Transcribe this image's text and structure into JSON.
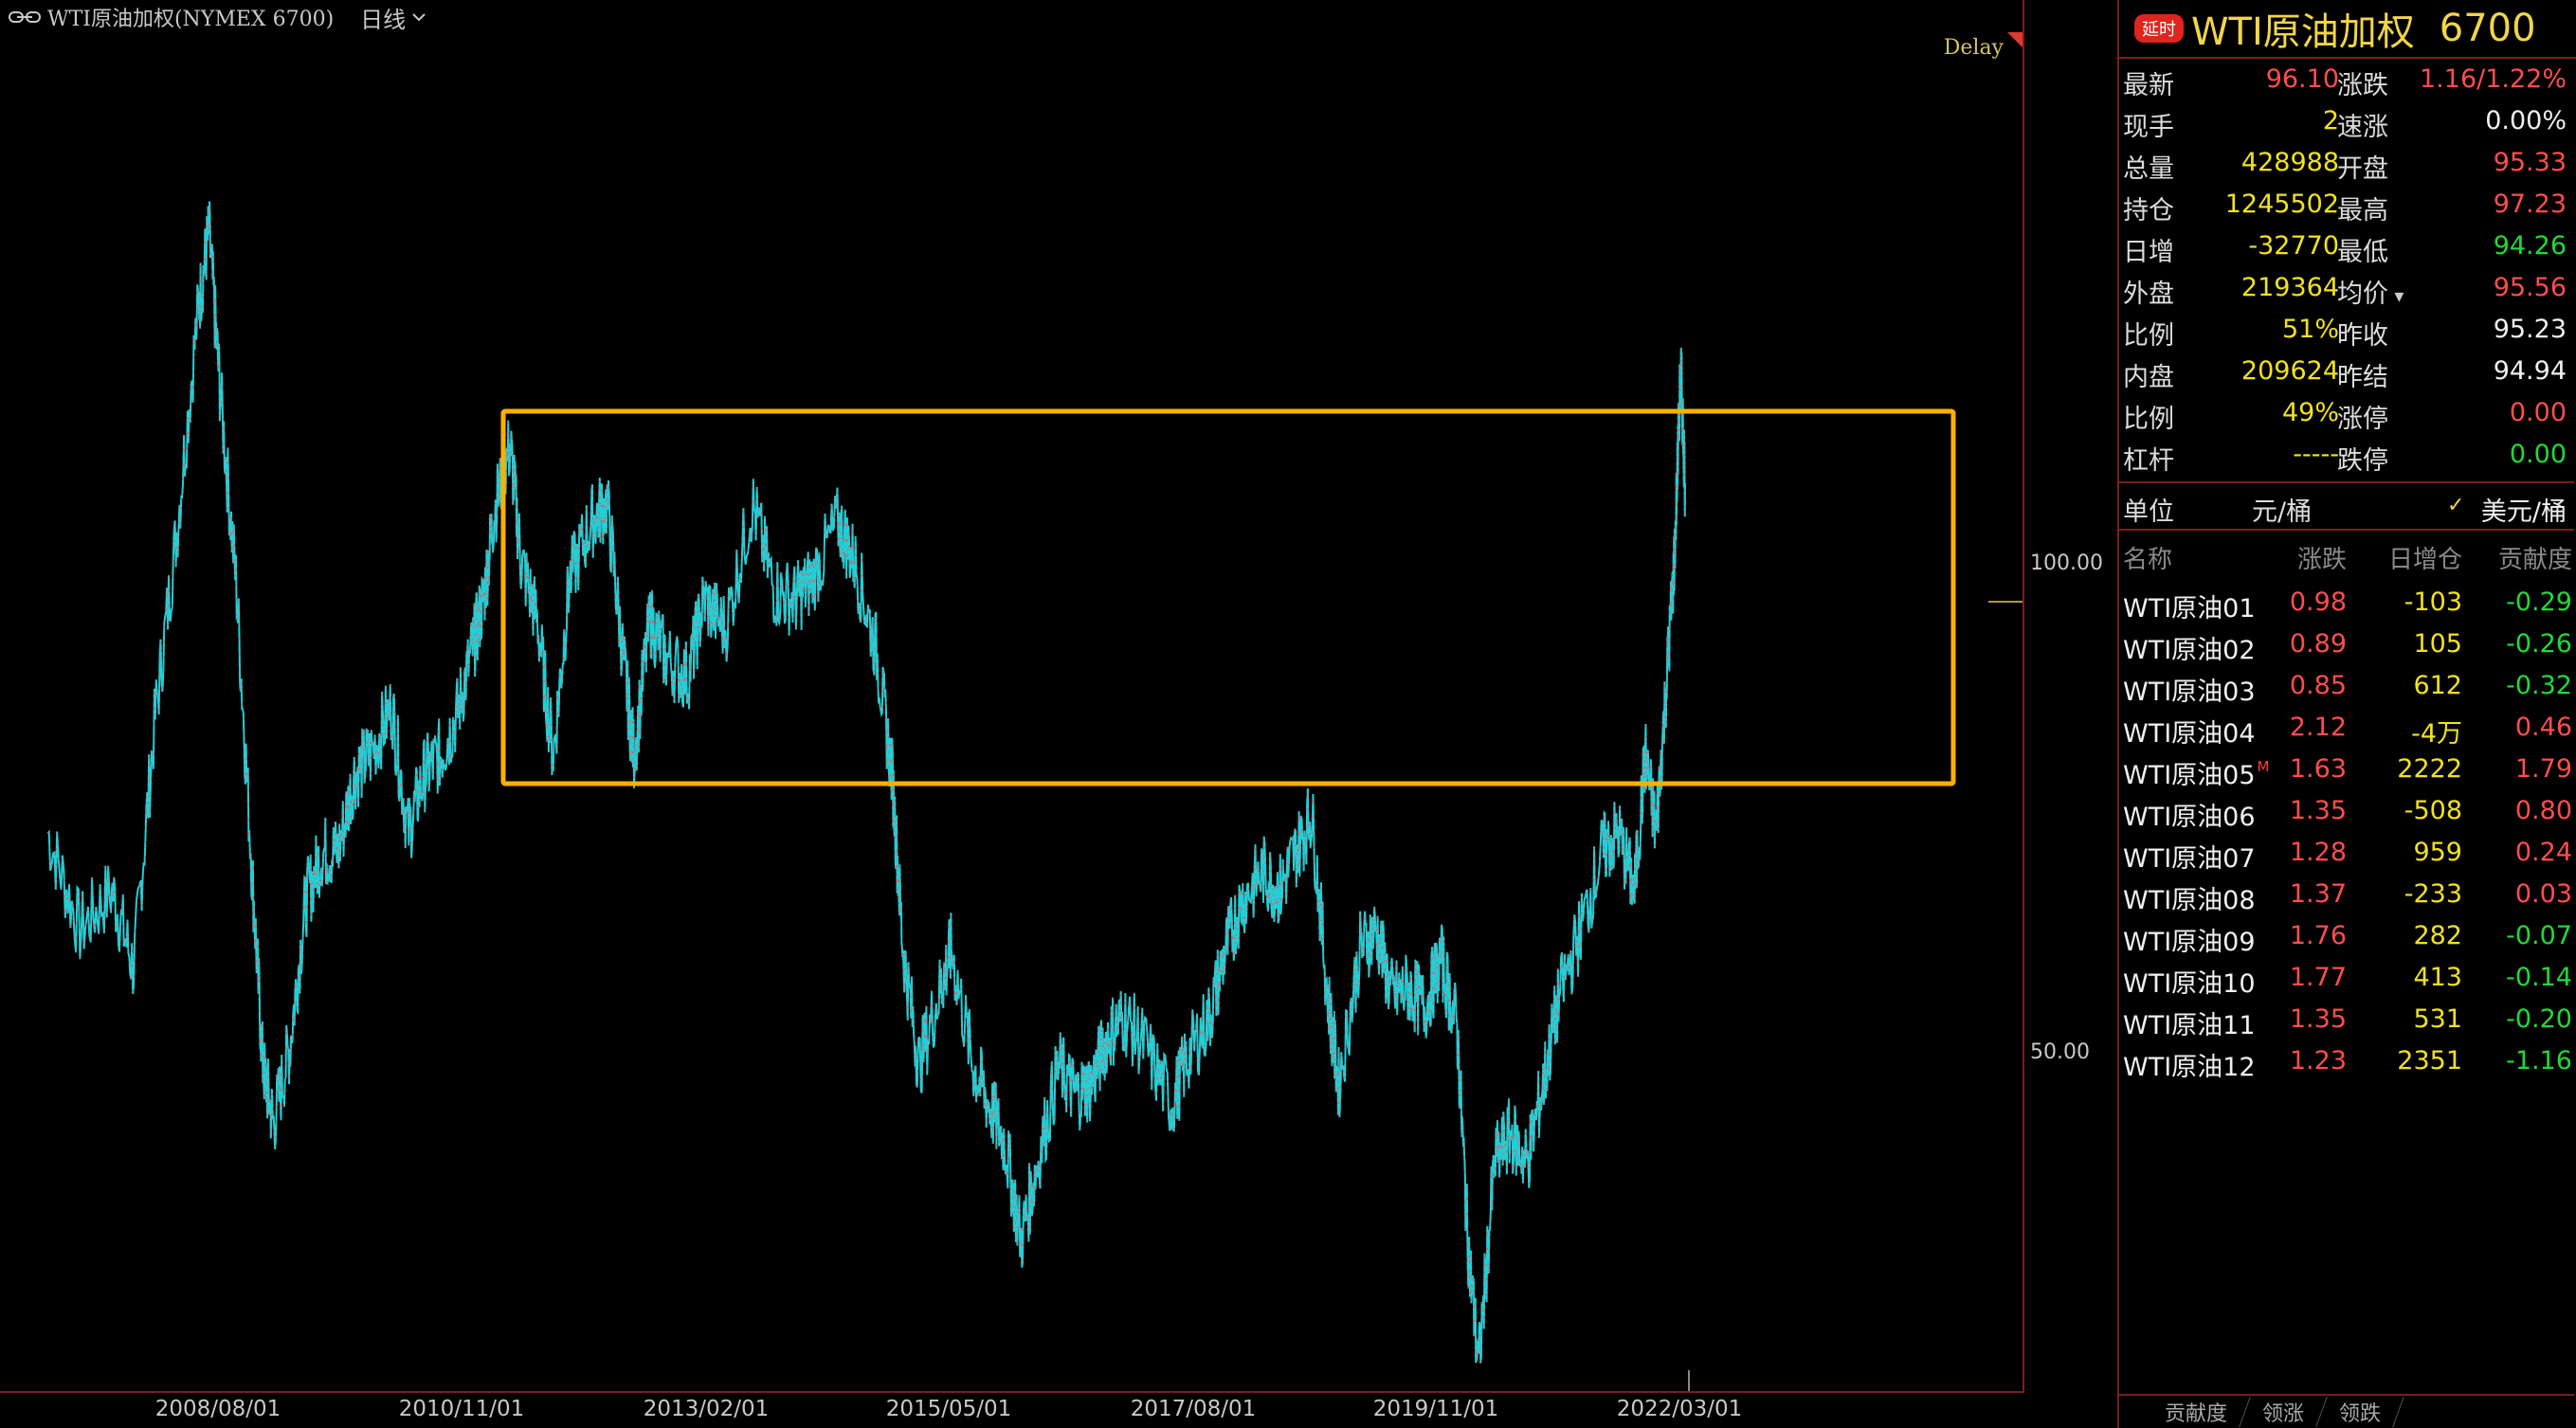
{
  "chart_header": {
    "title": "WTI原油加权(NYMEX 6700)",
    "period": "日线",
    "delay": "Delay"
  },
  "chart_data": {
    "type": "line",
    "title": "WTI原油加权(NYMEX 6700)",
    "y_ticks": [
      "100.00",
      "50.00"
    ],
    "x_ticks": [
      "2008/08/01",
      "2010/11/01",
      "2013/02/01",
      "2015/05/01",
      "2017/08/01",
      "2019/11/01",
      "2022/03/01"
    ],
    "ylim": [
      0,
      150
    ],
    "series": [
      {
        "values": [
          [
            2007.0,
            72
          ],
          [
            2007.3,
            62
          ],
          [
            2007.6,
            66
          ],
          [
            2007.8,
            58
          ],
          [
            2008.0,
            84
          ],
          [
            2008.2,
            103
          ],
          [
            2008.4,
            126
          ],
          [
            2008.5,
            134
          ],
          [
            2008.6,
            118
          ],
          [
            2008.75,
            98
          ],
          [
            2008.9,
            68
          ],
          [
            2009.0,
            48
          ],
          [
            2009.1,
            42
          ],
          [
            2009.25,
            50
          ],
          [
            2009.4,
            65
          ],
          [
            2009.55,
            70
          ],
          [
            2009.7,
            70
          ],
          [
            2009.85,
            78
          ],
          [
            2010.0,
            80
          ],
          [
            2010.2,
            85
          ],
          [
            2010.35,
            72
          ],
          [
            2010.5,
            78
          ],
          [
            2010.65,
            80
          ],
          [
            2010.8,
            84
          ],
          [
            2010.95,
            91
          ],
          [
            2011.05,
            96
          ],
          [
            2011.15,
            105
          ],
          [
            2011.3,
            112
          ],
          [
            2011.4,
            100
          ],
          [
            2011.55,
            94
          ],
          [
            2011.7,
            80
          ],
          [
            2011.85,
            98
          ],
          [
            2012.05,
            104
          ],
          [
            2012.2,
            106
          ],
          [
            2012.35,
            90
          ],
          [
            2012.45,
            80
          ],
          [
            2012.6,
            94
          ],
          [
            2012.75,
            90
          ],
          [
            2012.95,
            88
          ],
          [
            2013.1,
            96
          ],
          [
            2013.3,
            93
          ],
          [
            2013.55,
            106
          ],
          [
            2013.75,
            97
          ],
          [
            2013.95,
            96
          ],
          [
            2014.1,
            98
          ],
          [
            2014.35,
            104
          ],
          [
            2014.5,
            100
          ],
          [
            2014.7,
            91
          ],
          [
            2014.85,
            78
          ],
          [
            2014.95,
            60
          ],
          [
            2015.1,
            48
          ],
          [
            2015.3,
            56
          ],
          [
            2015.4,
            60
          ],
          [
            2015.6,
            48
          ],
          [
            2015.75,
            44
          ],
          [
            2015.9,
            40
          ],
          [
            2016.05,
            30
          ],
          [
            2016.2,
            38
          ],
          [
            2016.4,
            48
          ],
          [
            2016.55,
            45
          ],
          [
            2016.7,
            46
          ],
          [
            2016.85,
            51
          ],
          [
            2017.0,
            53
          ],
          [
            2017.2,
            50
          ],
          [
            2017.45,
            44
          ],
          [
            2017.6,
            49
          ],
          [
            2017.8,
            53
          ],
          [
            2017.95,
            60
          ],
          [
            2018.1,
            65
          ],
          [
            2018.3,
            68
          ],
          [
            2018.45,
            66
          ],
          [
            2018.6,
            70
          ],
          [
            2018.75,
            74
          ],
          [
            2018.9,
            55
          ],
          [
            2019.0,
            46
          ],
          [
            2019.2,
            60
          ],
          [
            2019.35,
            62
          ],
          [
            2019.5,
            55
          ],
          [
            2019.65,
            56
          ],
          [
            2019.8,
            54
          ],
          [
            2019.95,
            59
          ],
          [
            2020.1,
            52
          ],
          [
            2020.2,
            30
          ],
          [
            2020.3,
            17
          ],
          [
            2020.45,
            38
          ],
          [
            2020.6,
            41
          ],
          [
            2020.75,
            38
          ],
          [
            2020.9,
            46
          ],
          [
            2021.05,
            55
          ],
          [
            2021.25,
            62
          ],
          [
            2021.45,
            70
          ],
          [
            2021.6,
            72
          ],
          [
            2021.75,
            66
          ],
          [
            2021.85,
            80
          ],
          [
            2021.95,
            72
          ],
          [
            2022.05,
            88
          ],
          [
            2022.12,
            100
          ],
          [
            2022.18,
            120
          ],
          [
            2022.22,
            108
          ]
        ]
      }
    ]
  },
  "quote": {
    "badge": "延时",
    "name": "WTI原油加权",
    "code": "6700",
    "rows": [
      {
        "l1": "最新",
        "v1": "96.10",
        "c1": "red",
        "l2": "涨跌",
        "v2": "1.16/1.22%",
        "c2": "red"
      },
      {
        "l1": "现手",
        "v1": "2",
        "c1": "yel",
        "l2": "速涨",
        "v2": "0.00%",
        "c2": "wht"
      },
      {
        "l1": "总量",
        "v1": "428988",
        "c1": "yel",
        "l2": "开盘",
        "v2": "95.33",
        "c2": "red"
      },
      {
        "l1": "持仓",
        "v1": "1245502",
        "c1": "yel",
        "l2": "最高",
        "v2": "97.23",
        "c2": "red"
      },
      {
        "l1": "日增",
        "v1": "-32770",
        "c1": "yel",
        "l2": "最低",
        "v2": "94.26",
        "c2": "grn"
      },
      {
        "l1": "外盘",
        "v1": "219364",
        "c1": "yel",
        "l2": "均价",
        "v2": "95.56",
        "c2": "red"
      },
      {
        "l1": "比例",
        "v1": "51%",
        "c1": "yel",
        "l2": "昨收",
        "v2": "95.23",
        "c2": "wht"
      },
      {
        "l1": "内盘",
        "v1": "209624",
        "c1": "yel",
        "l2": "昨结",
        "v2": "94.94",
        "c2": "wht"
      },
      {
        "l1": "比例",
        "v1": "49%",
        "c1": "yel",
        "l2": "涨停",
        "v2": "0.00",
        "c2": "red"
      },
      {
        "l1": "杠杆",
        "v1": "-----",
        "c1": "yel",
        "l2": "跌停",
        "v2": "0.00",
        "c2": "grn"
      }
    ],
    "unit": {
      "label": "单位",
      "yuan": "元/桶",
      "usd": "美元/桶"
    }
  },
  "contracts": {
    "headers": {
      "name": "名称",
      "chg": "涨跌",
      "oi": "日增仓",
      "ctb": "贡献度"
    },
    "rows": [
      {
        "name": "WTI原油01",
        "chg": "0.98",
        "oi": "-103",
        "ctb": "-0.29"
      },
      {
        "name": "WTI原油02",
        "chg": "0.89",
        "oi": "105",
        "ctb": "-0.26"
      },
      {
        "name": "WTI原油03",
        "chg": "0.85",
        "oi": "612",
        "ctb": "-0.32"
      },
      {
        "name": "WTI原油04",
        "chg": "2.12",
        "oi": "-4万",
        "ctb": "0.46"
      },
      {
        "name": "WTI原油05",
        "chg": "1.63",
        "oi": "2222",
        "ctb": "1.79",
        "flag": "M"
      },
      {
        "name": "WTI原油06",
        "chg": "1.35",
        "oi": "-508",
        "ctb": "0.80"
      },
      {
        "name": "WTI原油07",
        "chg": "1.28",
        "oi": "959",
        "ctb": "0.24"
      },
      {
        "name": "WTI原油08",
        "chg": "1.37",
        "oi": "-233",
        "ctb": "0.03"
      },
      {
        "name": "WTI原油09",
        "chg": "1.76",
        "oi": "282",
        "ctb": "-0.07"
      },
      {
        "name": "WTI原油10",
        "chg": "1.77",
        "oi": "413",
        "ctb": "-0.14"
      },
      {
        "name": "WTI原油11",
        "chg": "1.35",
        "oi": "531",
        "ctb": "-0.20"
      },
      {
        "name": "WTI原油12",
        "chg": "1.23",
        "oi": "2351",
        "ctb": "-1.16"
      }
    ]
  },
  "bottom_tabs": [
    "贡献度",
    "领涨",
    "领跌"
  ],
  "colors": {
    "up": "#ff4d4d",
    "down": "#21d936",
    "volume_yellow": "#f1e21e",
    "line": "#20d0d8",
    "box": "#ffb000"
  }
}
